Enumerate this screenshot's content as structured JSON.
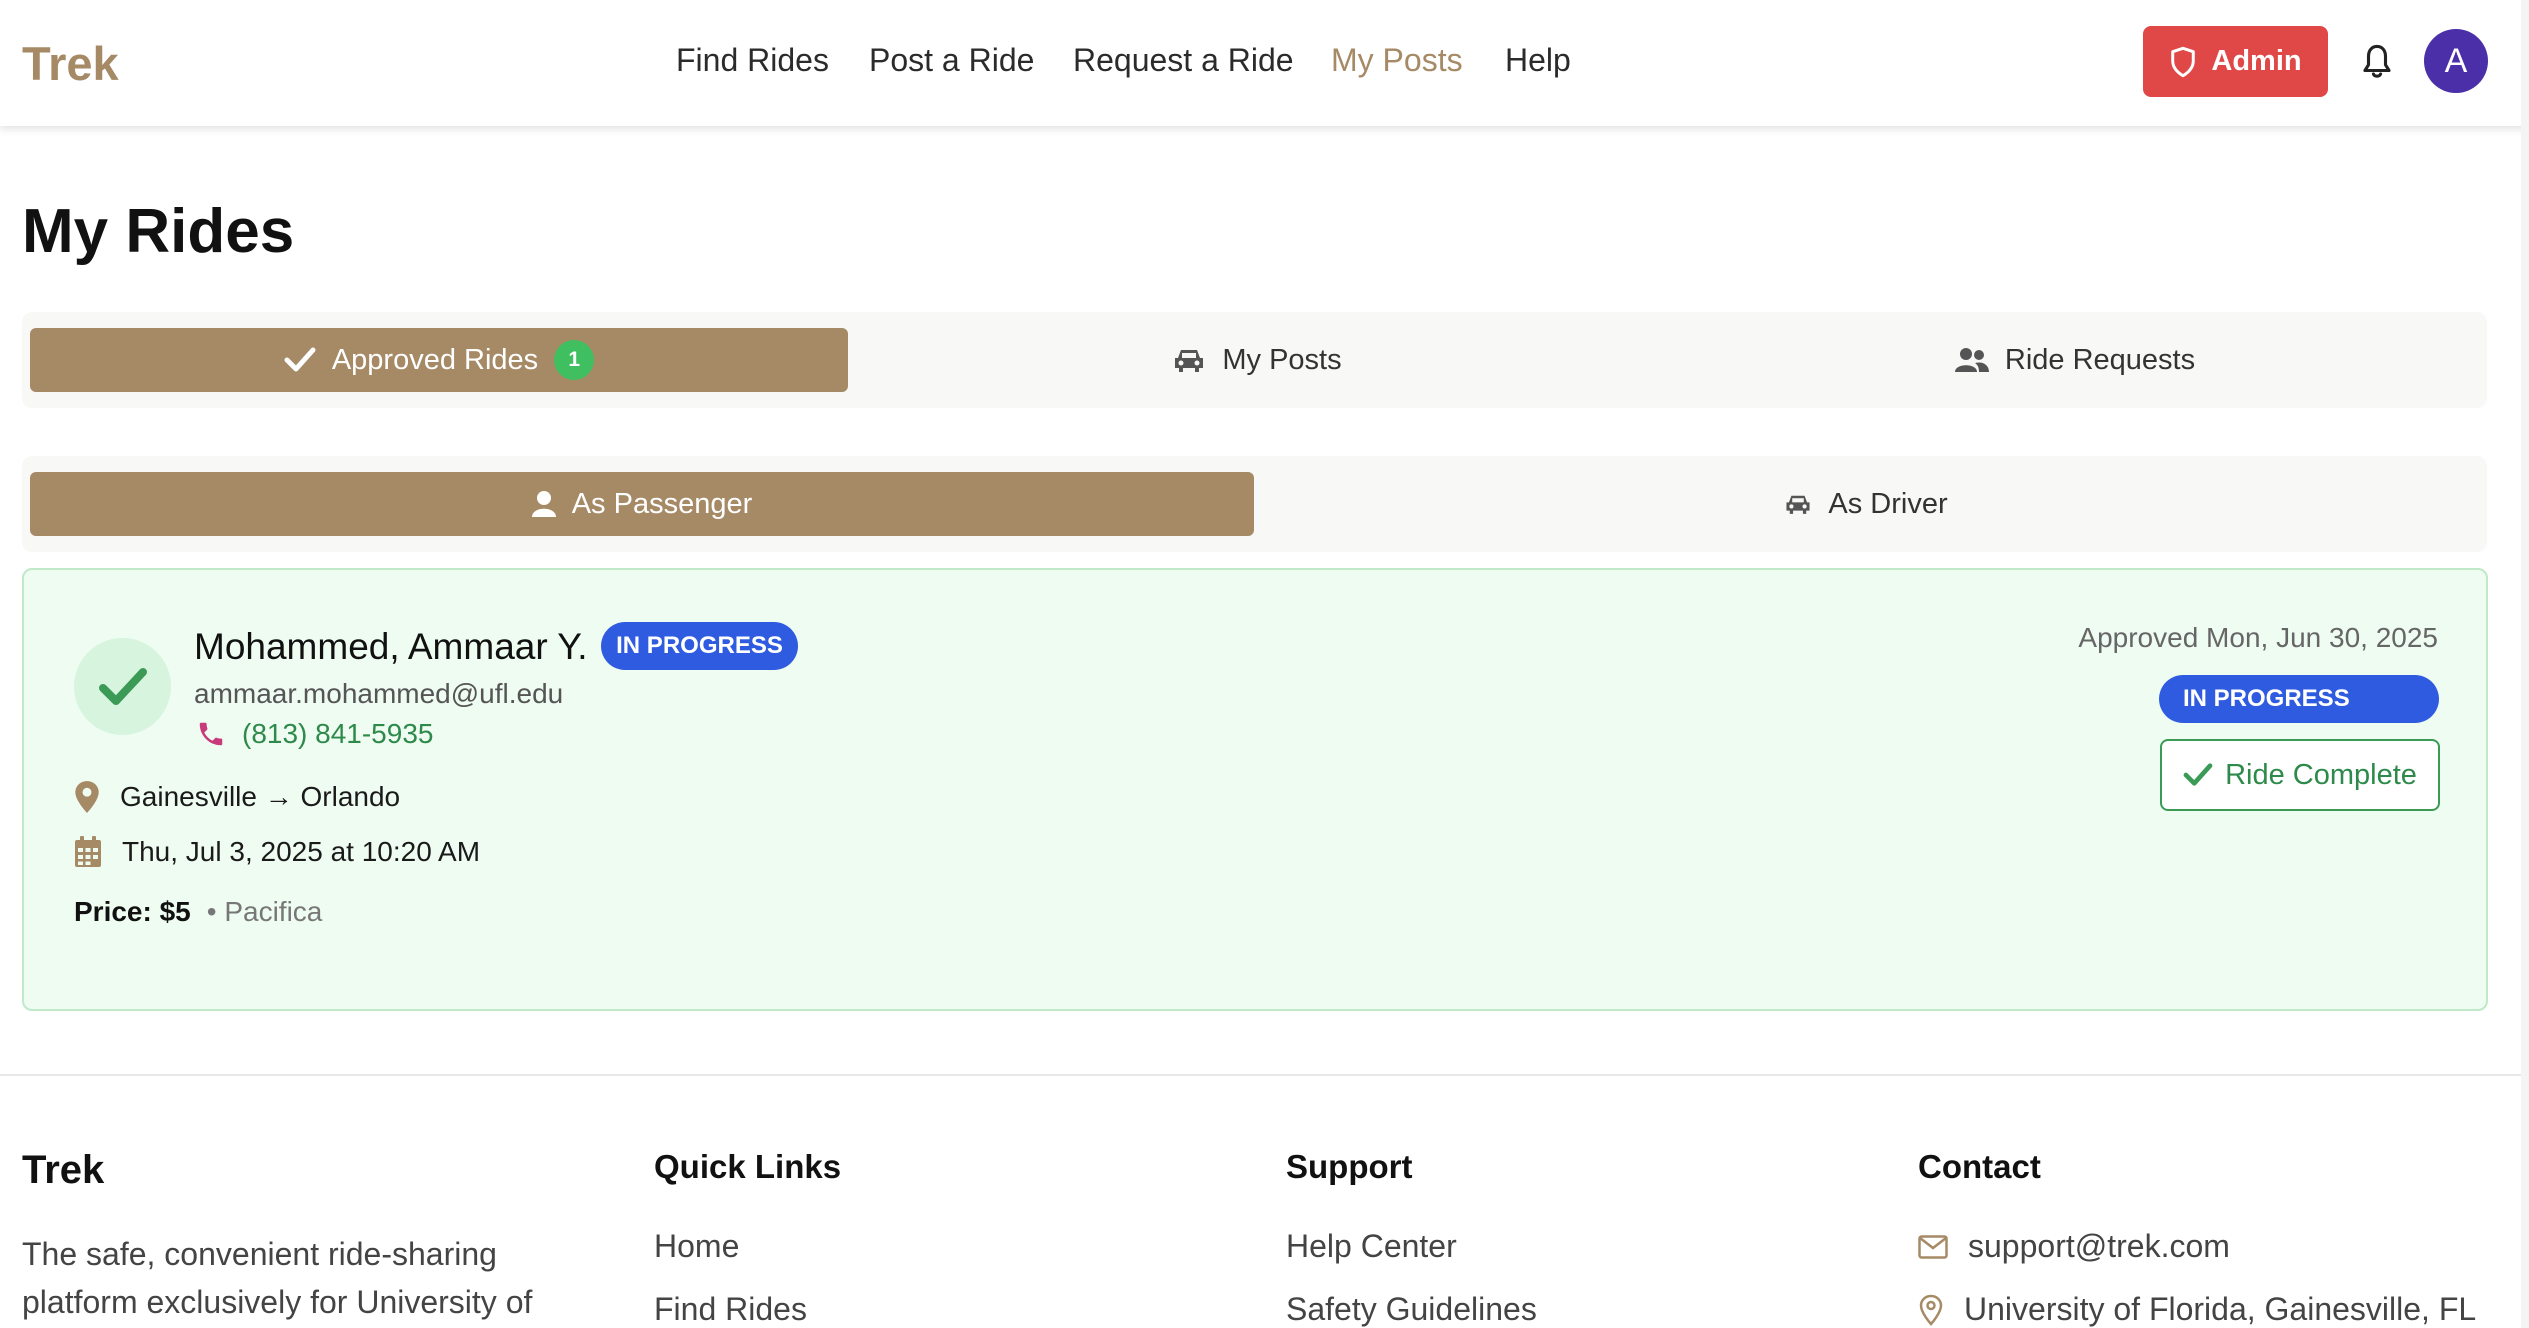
{
  "header": {
    "logo": "Trek",
    "nav": [
      "Find Rides",
      "Post a Ride",
      "Request a Ride",
      "My Posts",
      "Help"
    ],
    "active_nav": "My Posts",
    "admin_label": "Admin",
    "avatar_initial": "A"
  },
  "page": {
    "title": "My Rides"
  },
  "tabs": {
    "approved_label": "Approved Rides",
    "approved_count": "1",
    "posts_label": "My Posts",
    "requests_label": "Ride Requests"
  },
  "subtabs": {
    "passenger_label": "As Passenger",
    "driver_label": "As Driver"
  },
  "ride": {
    "name": "Mohammed, Ammaar Y.",
    "status": "IN PROGRESS",
    "email": "ammaar.mohammed@ufl.edu",
    "phone": "(813) 841-5935",
    "route": "Gainesville → Orlando",
    "datetime": "Thu, Jul 3, 2025 at 10:20 AM",
    "price_label": "Price: $5",
    "vehicle": "• Pacifica",
    "approved": "Approved Mon, Jun 30, 2025",
    "complete_label": "Ride Complete"
  },
  "footer": {
    "brand": "Trek",
    "description": "The safe, convenient ride-sharing platform exclusively for University of",
    "quick_links_title": "Quick Links",
    "quick_links": [
      "Home",
      "Find Rides"
    ],
    "support_title": "Support",
    "support_links": [
      "Help Center",
      "Safety Guidelines"
    ],
    "contact_title": "Contact",
    "contact_email": "support@trek.com",
    "contact_location": "University of Florida, Gainesville, FL"
  },
  "colors": {
    "brand": "#a68a66",
    "admin": "#e04848",
    "status": "#2f5be0",
    "success": "#2e8a4a"
  }
}
